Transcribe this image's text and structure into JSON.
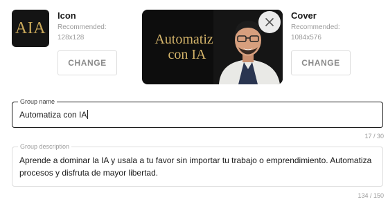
{
  "icon": {
    "title": "Icon",
    "recommended_label": "Recommended:",
    "recommended_size": "128x128",
    "change_label": "CHANGE",
    "logo_text": "AIA"
  },
  "cover": {
    "title": "Cover",
    "recommended_label": "Recommended:",
    "recommended_size": "1084x576",
    "change_label": "CHANGE",
    "image_text_line1": "Automatiza",
    "image_text_line2": "con IA"
  },
  "group_name": {
    "label": "Group name",
    "value": "Automatiza con IA",
    "counter": "17 / 30"
  },
  "group_description": {
    "label": "Group description",
    "value": "Aprende a dominar la IA y usala a tu favor sin importar tu trabajo o emprendimiento. Automatiza procesos y disfruta de mayor libertad.",
    "counter": "134 / 150"
  },
  "colors": {
    "gold": "#c9a85a",
    "dark": "#141414",
    "border_active": "#1a1a1a",
    "border_idle": "#dcdcdc"
  }
}
